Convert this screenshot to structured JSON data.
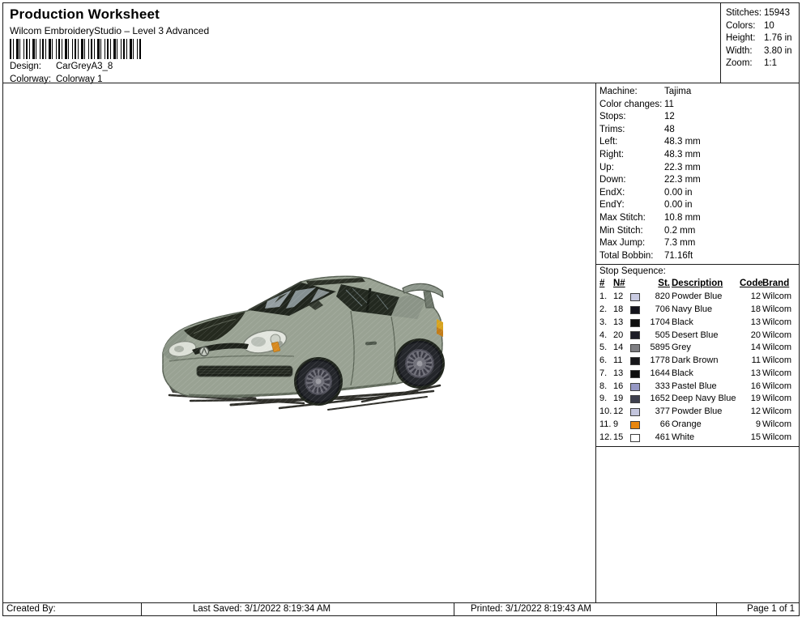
{
  "header": {
    "title": "Production Worksheet",
    "subtitle": "Wilcom EmbroideryStudio – Level 3 Advanced",
    "design_label": "Design:",
    "design_value": "CarGreyA3_8",
    "colorway_label": "Colorway:",
    "colorway_value": "Colorway 1"
  },
  "summary": {
    "rows": [
      {
        "label": "Stitches:",
        "value": "15943"
      },
      {
        "label": "Colors:",
        "value": "10"
      },
      {
        "label": "Height:",
        "value": "1.76 in"
      },
      {
        "label": "Width:",
        "value": "3.80 in"
      },
      {
        "label": "Zoom:",
        "value": "1:1"
      }
    ]
  },
  "machine_info": {
    "rows": [
      {
        "label": "Machine:",
        "value": "Tajima"
      },
      {
        "label": "Color changes:",
        "value": "11"
      },
      {
        "label": "Stops:",
        "value": "12"
      },
      {
        "label": "Trims:",
        "value": "48"
      },
      {
        "label": "Left:",
        "value": "48.3 mm"
      },
      {
        "label": "Right:",
        "value": "48.3 mm"
      },
      {
        "label": "Up:",
        "value": "22.3 mm"
      },
      {
        "label": "Down:",
        "value": "22.3 mm"
      },
      {
        "label": "EndX:",
        "value": "0.00 in"
      },
      {
        "label": "EndY:",
        "value": "0.00 in"
      },
      {
        "label": "Max Stitch:",
        "value": "10.8 mm"
      },
      {
        "label": "Min Stitch:",
        "value": "0.2 mm"
      },
      {
        "label": "Max Jump:",
        "value": "7.3 mm"
      },
      {
        "label": "Total Bobbin:",
        "value": "71.16ft"
      }
    ]
  },
  "stop_sequence": {
    "title": "Stop Sequence:",
    "headers": {
      "num": "#",
      "needle": "N#",
      "st": "St.",
      "description": "Description",
      "code": "Code",
      "brand": "Brand"
    },
    "rows": [
      {
        "num": "1.",
        "needle": "12",
        "swatch": "#c9cbe2",
        "st": "820",
        "description": "Powder Blue",
        "code": "12",
        "brand": "Wilcom"
      },
      {
        "num": "2.",
        "needle": "18",
        "swatch": "#14141c",
        "st": "706",
        "description": "Navy Blue",
        "code": "18",
        "brand": "Wilcom"
      },
      {
        "num": "3.",
        "needle": "13",
        "swatch": "#0e0e0e",
        "st": "1704",
        "description": "Black",
        "code": "13",
        "brand": "Wilcom"
      },
      {
        "num": "4.",
        "needle": "20",
        "swatch": "#1d1d27",
        "st": "505",
        "description": "Desert Blue",
        "code": "20",
        "brand": "Wilcom"
      },
      {
        "num": "5.",
        "needle": "14",
        "swatch": "#7e7e82",
        "st": "5895",
        "description": "Grey",
        "code": "14",
        "brand": "Wilcom"
      },
      {
        "num": "6.",
        "needle": "11",
        "swatch": "#17171a",
        "st": "1778",
        "description": "Dark Brown",
        "code": "11",
        "brand": "Wilcom"
      },
      {
        "num": "7.",
        "needle": "13",
        "swatch": "#0e0e0e",
        "st": "1644",
        "description": "Black",
        "code": "13",
        "brand": "Wilcom"
      },
      {
        "num": "8.",
        "needle": "16",
        "swatch": "#9597c4",
        "st": "333",
        "description": "Pastel Blue",
        "code": "16",
        "brand": "Wilcom"
      },
      {
        "num": "9.",
        "needle": "19",
        "swatch": "#3e404e",
        "st": "1652",
        "description": "Deep Navy Blue",
        "code": "19",
        "brand": "Wilcom"
      },
      {
        "num": "10.",
        "needle": "12",
        "swatch": "#c3c5dd",
        "st": "377",
        "description": "Powder Blue",
        "code": "12",
        "brand": "Wilcom"
      },
      {
        "num": "11.",
        "needle": "9",
        "swatch": "#e8860f",
        "st": "66",
        "description": "Orange",
        "code": "9",
        "brand": "Wilcom"
      },
      {
        "num": "12.",
        "needle": "15",
        "swatch": "#ffffff",
        "st": "461",
        "description": "White",
        "code": "15",
        "brand": "Wilcom"
      }
    ]
  },
  "design_preview": {
    "alt": "Embroidered grey sports coupe, front three-quarter view, dark hood and windows, rear spoiler",
    "body_color": "#99a293",
    "hood_color": "#252a1f",
    "glass_color": "#232920",
    "highlight_color": "#a9b4b8",
    "accent_orange": "#d7891e",
    "shadow_color": "#2e2e29"
  },
  "footer": {
    "created_by": "Created By:",
    "last_saved": "Last Saved: 3/1/2022 8:19:34 AM",
    "printed": "Printed: 3/1/2022 8:19:43 AM",
    "page": "Page 1 of 1"
  }
}
